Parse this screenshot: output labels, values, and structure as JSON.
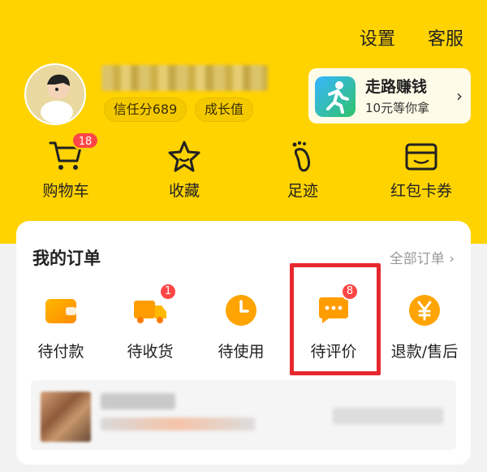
{
  "header": {
    "settings_label": "设置",
    "service_label": "客服"
  },
  "profile": {
    "credit_label": "信任分689",
    "growth_label": "成长值"
  },
  "walk_card": {
    "title": "走路赚钱",
    "subtitle": "10元等你拿"
  },
  "quick_links": {
    "cart": {
      "label": "购物车",
      "badge": "18"
    },
    "favorites": {
      "label": "收藏"
    },
    "footprints": {
      "label": "足迹"
    },
    "coupons": {
      "label": "红包卡券"
    }
  },
  "orders": {
    "title": "我的订单",
    "view_all": "全部订单 ›",
    "items": [
      {
        "label": "待付款"
      },
      {
        "label": "待收货",
        "badge": "1"
      },
      {
        "label": "待使用"
      },
      {
        "label": "待评价",
        "badge": "8"
      },
      {
        "label": "退款/售后"
      }
    ]
  },
  "colors": {
    "brand": "#ffd300",
    "accent": "#ff9d00",
    "badge": "#ff4646",
    "highlight": "#e8282f"
  }
}
